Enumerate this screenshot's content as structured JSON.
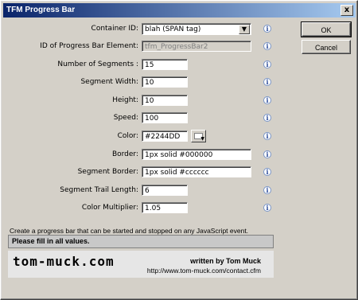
{
  "window": {
    "title": "TFM Progress Bar",
    "close_label": "x"
  },
  "form": {
    "container_id": {
      "label": "Container ID:",
      "value": "blah (SPAN tag)"
    },
    "progress_id": {
      "label": "ID of Progress Bar Element:",
      "value": "tfm_ProgressBar2"
    },
    "segments": {
      "label": "Number of Segments :",
      "value": "15"
    },
    "segment_width": {
      "label": "Segment Width:",
      "value": "10"
    },
    "height": {
      "label": "Height:",
      "value": "10"
    },
    "speed": {
      "label": "Speed:",
      "value": "100"
    },
    "color": {
      "label": "Color:",
      "value": "#2244DD"
    },
    "border": {
      "label": "Border:",
      "value": "1px solid #000000"
    },
    "segment_border": {
      "label": "Segment Border:",
      "value": "1px solid #cccccc"
    },
    "trail_length": {
      "label": "Segment Trail Length:",
      "value": "6"
    },
    "color_multiplier": {
      "label": "Color Multiplier:",
      "value": "1.05"
    }
  },
  "buttons": {
    "ok": "OK",
    "cancel": "Cancel"
  },
  "info_glyph": "i",
  "description": "Create a progress bar that can be started and stopped on any JavaScript event.",
  "status": "Please fill in all values.",
  "footer": {
    "brand": "tom-muck.com",
    "written_by": "written by Tom Muck",
    "url": "http://www.tom-muck.com/contact.cfm"
  },
  "colors": {
    "titlebar_start": "#0a246a",
    "titlebar_end": "#a6caf0",
    "dialog_bg": "#d4d0c8"
  }
}
